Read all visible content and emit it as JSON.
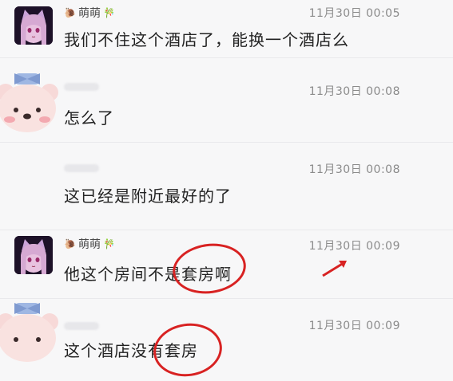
{
  "messages": [
    {
      "sender": "萌萌",
      "sender_emoji": "🎋",
      "time": "11月30日 00:05",
      "text": "我们不住这个酒店了，能换一个酒店么"
    },
    {
      "sender": "",
      "time": "11月30日 00:08",
      "text": "怎么了"
    },
    {
      "sender": "",
      "time": "11月30日 00:08",
      "text": "这已经是附近最好的了"
    },
    {
      "sender": "萌萌",
      "sender_emoji": "🎋",
      "time": "11月30日 00:09",
      "text": "他这个房间不是套房啊"
    },
    {
      "sender": "",
      "time": "11月30日 00:09",
      "text": "这个酒店没有套房"
    }
  ],
  "colors": {
    "annotation": "#d82222",
    "timestamp": "#8b8b8b",
    "text": "#222222"
  },
  "icons": [
    "snail-icon",
    "bamboo-icon",
    "arrow-annotation-icon"
  ]
}
